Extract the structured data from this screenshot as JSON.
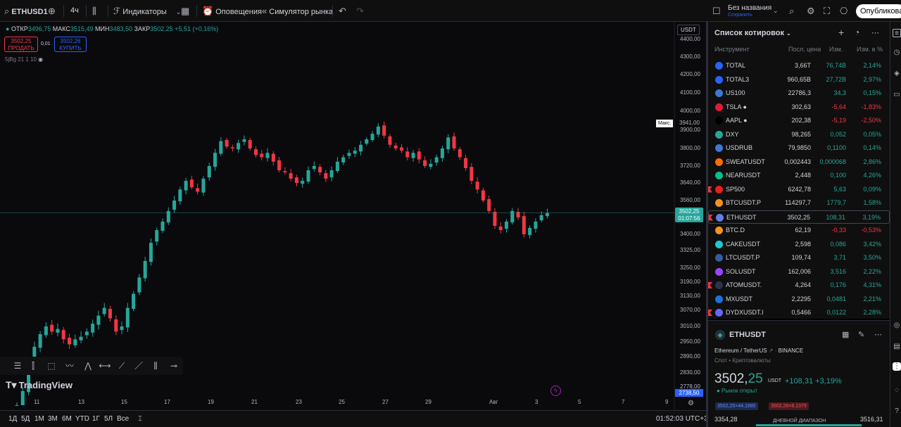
{
  "toolbar": {
    "symbol": "ETHUSD1",
    "interval": "4ч",
    "indicators": "Индикаторы",
    "alerts": "Оповещения",
    "replay": "Симулятор рынка",
    "layout_name": "Без названия",
    "layout_status": "Сохранить",
    "publish": "Опубликовать"
  },
  "chart": {
    "ohlc": {
      "open_label": "ОТКР",
      "open": "3496,75",
      "high_label": "МАКС",
      "high": "3515,49",
      "low_label": "МИН",
      "low": "3483,50",
      "close_label": "ЗАКР",
      "close": "3502,25",
      "change": "+5,51 (+0,16%)"
    },
    "sell_price": "3502,25",
    "sell_label": "ПРОДАТЬ",
    "spread": "0,01",
    "buy_price": "3502,26",
    "buy_label": "КУПИТЬ",
    "indicator_line": "5jBg 21 1 10",
    "currency": "USDT",
    "max_label": "Макс.",
    "max_value": "3941,00",
    "current_price": "3502,25",
    "countdown": "01:07:56",
    "low_marker": "2738,50",
    "brand": "TradingView"
  },
  "chart_data": {
    "type": "candlestick",
    "y_ticks": [
      "4400,00",
      "4300,00",
      "4200,00",
      "4100,00",
      "4000,00",
      "3900,00",
      "3800,00",
      "3720,00",
      "3640,00",
      "3560,00",
      "3400,00",
      "3325,00",
      "3250,00",
      "3190,00",
      "3130,00",
      "3070,00",
      "3010,00",
      "2950,00",
      "2890,00",
      "2830,00",
      "2778,00"
    ],
    "x_ticks": [
      "11",
      "13",
      "15",
      "17",
      "19",
      "21",
      "23",
      "25",
      "27",
      "29",
      "Авг",
      "3",
      "5",
      "7",
      "9"
    ],
    "close_path": [
      2700,
      2760,
      2850,
      2930,
      2980,
      3010,
      2990,
      3000,
      2960,
      2940,
      2960,
      2970,
      2990,
      3020,
      3050,
      3080,
      3040,
      2990,
      3010,
      3080,
      3140,
      3210,
      3280,
      3360,
      3420,
      3460,
      3510,
      3560,
      3610,
      3650,
      3620,
      3600,
      3660,
      3720,
      3780,
      3840,
      3810,
      3800,
      3830,
      3850,
      3800,
      3770,
      3760,
      3780,
      3740,
      3700,
      3690,
      3660,
      3640,
      3650,
      3700,
      3720,
      3690,
      3660,
      3700,
      3740,
      3760,
      3780,
      3790,
      3820,
      3850,
      3880,
      3920,
      3870,
      3820,
      3800,
      3790,
      3760,
      3780,
      3750,
      3720,
      3730,
      3760,
      3800,
      3860,
      3800,
      3760,
      3710,
      3650,
      3610,
      3560,
      3510,
      3440,
      3420,
      3460,
      3510,
      3480,
      3400,
      3430,
      3460,
      3490,
      3500
    ],
    "current": 3502.25,
    "high_marker": 3941.0
  },
  "bottombar": {
    "ranges": [
      "1Д",
      "5Д",
      "1М",
      "3М",
      "6М",
      "YTD",
      "1Г",
      "5Л",
      "Все"
    ],
    "clock": "01:52:03 UTC+3"
  },
  "watchlist": {
    "title": "Список котировок",
    "headers": {
      "instrument": "Инструмент",
      "last": "Посл. цена",
      "chg": "Изм.",
      "chg_pct": "Изм. в %"
    },
    "rows": [
      {
        "sym": "TOTAL",
        "last": "3,66T",
        "chg": "76,74B",
        "pct": "2,14%",
        "dir": "up",
        "ico": "#2962ff",
        "flag": false
      },
      {
        "sym": "TOTAL3",
        "last": "960,65B",
        "chg": "27,72B",
        "pct": "2,97%",
        "dir": "up",
        "ico": "#2962ff",
        "flag": false
      },
      {
        "sym": "US100",
        "last": "22786,3",
        "chg": "34,3",
        "pct": "0,15%",
        "dir": "up",
        "ico": "#3c78d8",
        "flag": false
      },
      {
        "sym": "TSLA ●",
        "last": "302,63",
        "chg": "-5,64",
        "pct": "-1,83%",
        "dir": "dn",
        "ico": "#e31937",
        "flag": false
      },
      {
        "sym": "AAPL ●",
        "last": "202,38",
        "chg": "-5,19",
        "pct": "-2,50%",
        "dir": "dn",
        "ico": "#000000",
        "flag": false
      },
      {
        "sym": "DXY",
        "last": "98,265",
        "chg": "0,052",
        "pct": "0,05%",
        "dir": "up",
        "ico": "#26a69a",
        "flag": false
      },
      {
        "sym": "USDRUB",
        "last": "79,9850",
        "chg": "0,1100",
        "pct": "0,14%",
        "dir": "up",
        "ico": "#3c78d8",
        "flag": false
      },
      {
        "sym": "SWEATUSDT",
        "last": "0,002443",
        "chg": "0,000068",
        "pct": "2,86%",
        "dir": "up",
        "ico": "#ff6d00",
        "flag": false
      },
      {
        "sym": "NEARUSDT",
        "last": "2,448",
        "chg": "0,100",
        "pct": "4,26%",
        "dir": "up",
        "ico": "#00c08b",
        "flag": false
      },
      {
        "sym": "SP500",
        "last": "6242,78",
        "chg": "5,63",
        "pct": "0,09%",
        "dir": "up",
        "ico": "#e91e1e",
        "flag": true
      },
      {
        "sym": "BTCUSDT.P",
        "last": "114297,7",
        "chg": "1779,7",
        "pct": "1,58%",
        "dir": "up",
        "ico": "#f7931a",
        "flag": false
      },
      {
        "sym": "ETHUSDT",
        "last": "3502,25",
        "chg": "108,31",
        "pct": "3,19%",
        "dir": "up",
        "ico": "#627eea",
        "flag": true,
        "sel": true
      },
      {
        "sym": "BTC.D",
        "last": "62,19",
        "chg": "-0,33",
        "pct": "-0,53%",
        "dir": "dn",
        "ico": "#f7931a",
        "flag": false
      },
      {
        "sym": "CAKEUSDT",
        "last": "2,598",
        "chg": "0,086",
        "pct": "3,42%",
        "dir": "up",
        "ico": "#1fc7d4",
        "flag": false
      },
      {
        "sym": "LTCUSDT.P",
        "last": "109,74",
        "chg": "3,71",
        "pct": "3,50%",
        "dir": "up",
        "ico": "#345d9d",
        "flag": false
      },
      {
        "sym": "SOLUSDT",
        "last": "162,006",
        "chg": "3,516",
        "pct": "2,22%",
        "dir": "up",
        "ico": "#9945ff",
        "flag": false
      },
      {
        "sym": "ATOMUSDT.",
        "last": "4,264",
        "chg": "0,176",
        "pct": "4,31%",
        "dir": "up",
        "ico": "#2e3148",
        "flag": true
      },
      {
        "sym": "MXUSDT",
        "last": "2,2295",
        "chg": "0,0481",
        "pct": "2,21%",
        "dir": "up",
        "ico": "#1972e2",
        "flag": false
      },
      {
        "sym": "DYDXUSDT.I",
        "last": "0,5466",
        "chg": "0,0122",
        "pct": "2,28%",
        "dir": "up",
        "ico": "#6966ff",
        "flag": true
      }
    ]
  },
  "details": {
    "symbol": "ETHUSDT",
    "description": "Ethereum / TetherUS",
    "exchange": "BINANCE",
    "type": "Спот • Криптовалюты",
    "price_int": "3502,",
    "price_dec": "25",
    "currency": "USDT",
    "change": "+108,31  +3,19%",
    "market": "● Рынок открыт",
    "bid": "3502,25×44,1885",
    "ask": "3502,26×8,1379",
    "low": "3354,28",
    "range_label": "ДНЕВНОЙ ДИАПАЗОН",
    "high": "3516,31"
  },
  "colors": {
    "up": "#26a69a",
    "down": "#f23645",
    "accent": "#2962ff"
  }
}
